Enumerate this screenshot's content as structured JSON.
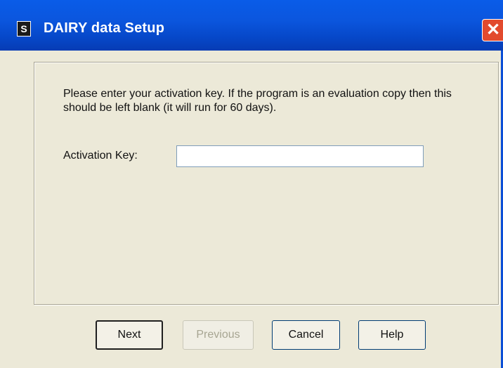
{
  "window": {
    "title": "DAIRY data Setup",
    "app_icon": "S",
    "close_glyph": "✕"
  },
  "form": {
    "instructions": "Please enter your activation key. If the program is an evaluation copy then this should be left blank (it will run for 60 days).",
    "activation_label": "Activation Key:",
    "activation_value": ""
  },
  "buttons": {
    "next": "Next",
    "previous": "Previous",
    "cancel": "Cancel",
    "help": "Help"
  },
  "colors": {
    "titlebar": "#0a5ce8",
    "close_button": "#e24a2e",
    "dialog_background": "#ece9d8"
  }
}
